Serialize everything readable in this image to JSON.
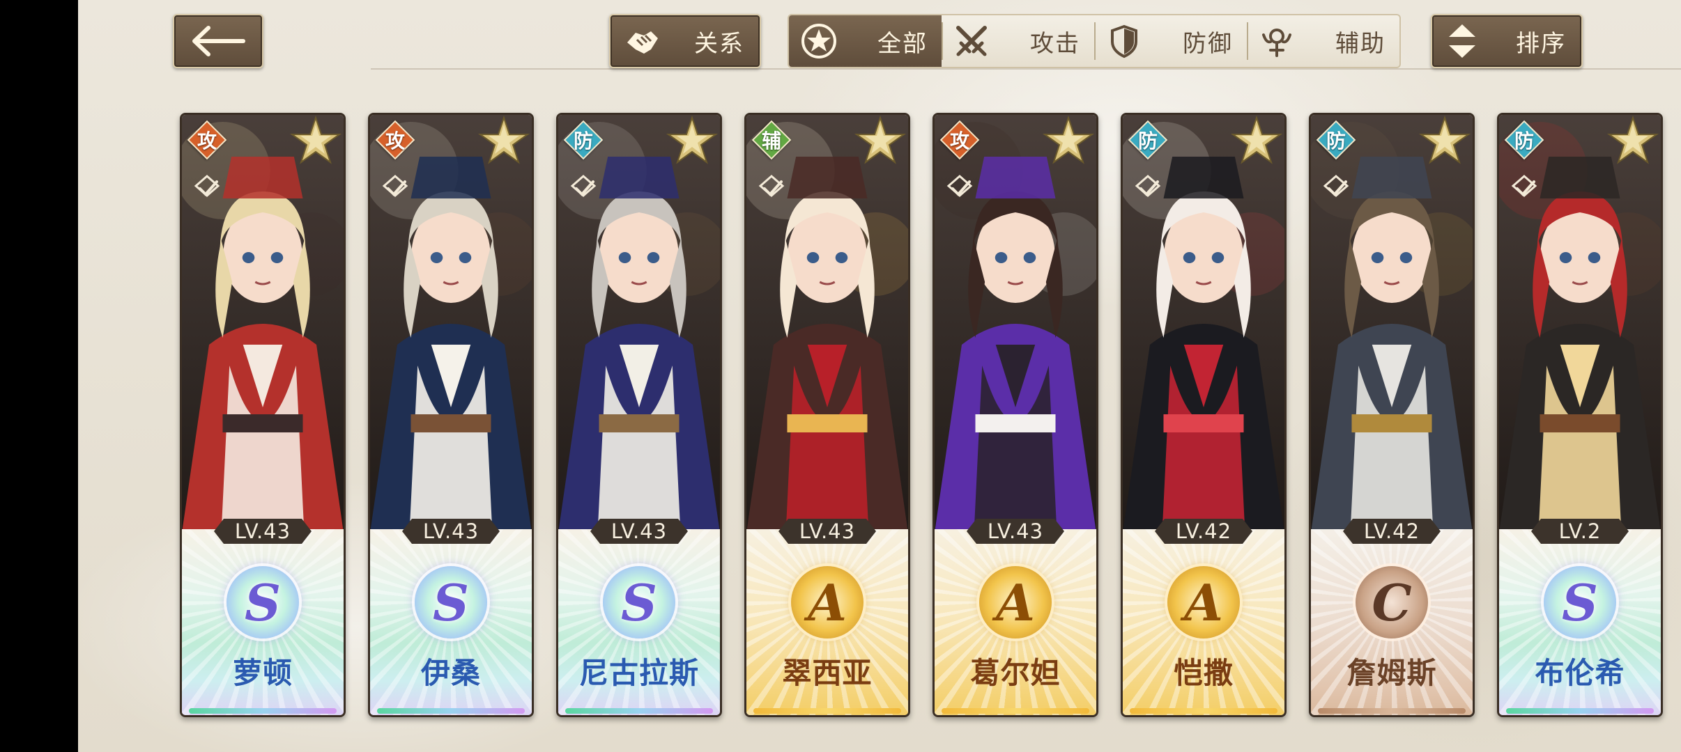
{
  "top_bar": {
    "relations_label": "关系",
    "sort_label": "排序",
    "filters": [
      {
        "label": "全部",
        "icon": "star-circle-icon",
        "active": true
      },
      {
        "label": "攻击",
        "icon": "crossed-swords-icon",
        "active": false
      },
      {
        "label": "防御",
        "icon": "shield-icon",
        "active": false
      },
      {
        "label": "辅助",
        "icon": "support-icon",
        "active": false
      }
    ]
  },
  "characters": [
    {
      "role": "攻",
      "level": "LV.43",
      "rarity": "S",
      "name": "萝顿",
      "palette": [
        "#b4312c",
        "#f4e9df",
        "#3b2a2a",
        "#e8d7a8"
      ]
    },
    {
      "role": "攻",
      "level": "LV.43",
      "rarity": "S",
      "name": "伊桑",
      "palette": [
        "#1f2f52",
        "#f5f2ea",
        "#7a5236",
        "#d9d2c4"
      ]
    },
    {
      "role": "防",
      "level": "LV.43",
      "rarity": "S",
      "name": "尼古拉斯",
      "palette": [
        "#2d2e6e",
        "#f2efe6",
        "#8b6a44",
        "#c8c3bd"
      ]
    },
    {
      "role": "辅",
      "level": "LV.43",
      "rarity": "A",
      "name": "翠西亚",
      "palette": [
        "#4a2a26",
        "#b82029",
        "#e9b552",
        "#f5e7d4"
      ]
    },
    {
      "role": "攻",
      "level": "LV.43",
      "rarity": "A",
      "name": "葛尔妲",
      "palette": [
        "#5b2ea8",
        "#2b2230",
        "#f3f0ee",
        "#3a2722"
      ]
    },
    {
      "role": "防",
      "level": "LV.42",
      "rarity": "A",
      "name": "恺撒",
      "palette": [
        "#1b1b20",
        "#c22433",
        "#e0434d",
        "#f3ece6"
      ]
    },
    {
      "role": "防",
      "level": "LV.42",
      "rarity": "C",
      "name": "詹姆斯",
      "palette": [
        "#3f4552",
        "#e6e4e0",
        "#b08a3c",
        "#6c5a46"
      ]
    },
    {
      "role": "防",
      "level": "LV.2",
      "rarity": "S",
      "name": "布伦希",
      "palette": [
        "#2b2725",
        "#f1d79a",
        "#7a4b2c",
        "#b52a2a"
      ]
    }
  ],
  "role_colors": {
    "攻": "#d6602a",
    "防": "#3aaac0",
    "辅": "#62a843"
  }
}
